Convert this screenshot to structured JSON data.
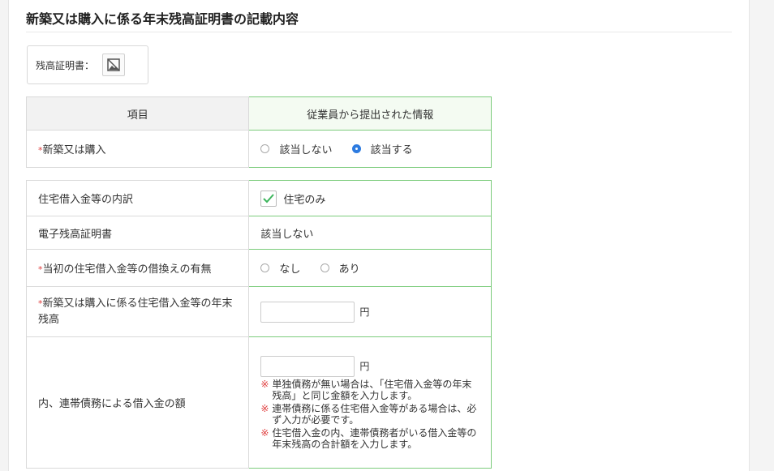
{
  "page": {
    "title": "新築又は購入に係る年末残高証明書の記載内容"
  },
  "certificate": {
    "label": "残高証明書：",
    "icon": "image-unavailable-icon"
  },
  "table1": {
    "header_item": "項目",
    "header_info": "従業員から提出された情報",
    "row_label": "新築又は購入",
    "options": [
      "該当しない",
      "該当する"
    ],
    "selected": "該当する"
  },
  "table2": {
    "breakdown": {
      "label": "住宅借入金等の内訳",
      "checkbox_label": "住宅のみ",
      "checked": true
    },
    "electronic": {
      "label": "電子残高証明書",
      "value": "該当しない"
    },
    "refinance": {
      "label": "当初の住宅借入金等の借換えの有無",
      "options": [
        "なし",
        "あり"
      ],
      "selected": ""
    },
    "year_end_balance": {
      "label": "新築又は購入に係る住宅借入金等の年末残高",
      "value": "",
      "unit": "円"
    },
    "joint_debt": {
      "label": "内、連帯債務による借入金の額",
      "value": "",
      "unit": "円",
      "notes": [
        "単独債務が無い場合は、「住宅借入金等の年末残高」と同じ金額を入力します。",
        "連帯債務に係る住宅借入金等がある場合は、必ず入力が必要です。",
        "住宅借入金の内、連帯債務者がいる借入金等の年末残高の合計額を入力します。"
      ],
      "note_mark": "※"
    }
  },
  "colors": {
    "accent_green": "#7ccc7c",
    "radio_blue": "#2d7be0",
    "required_red": "#e04040"
  }
}
